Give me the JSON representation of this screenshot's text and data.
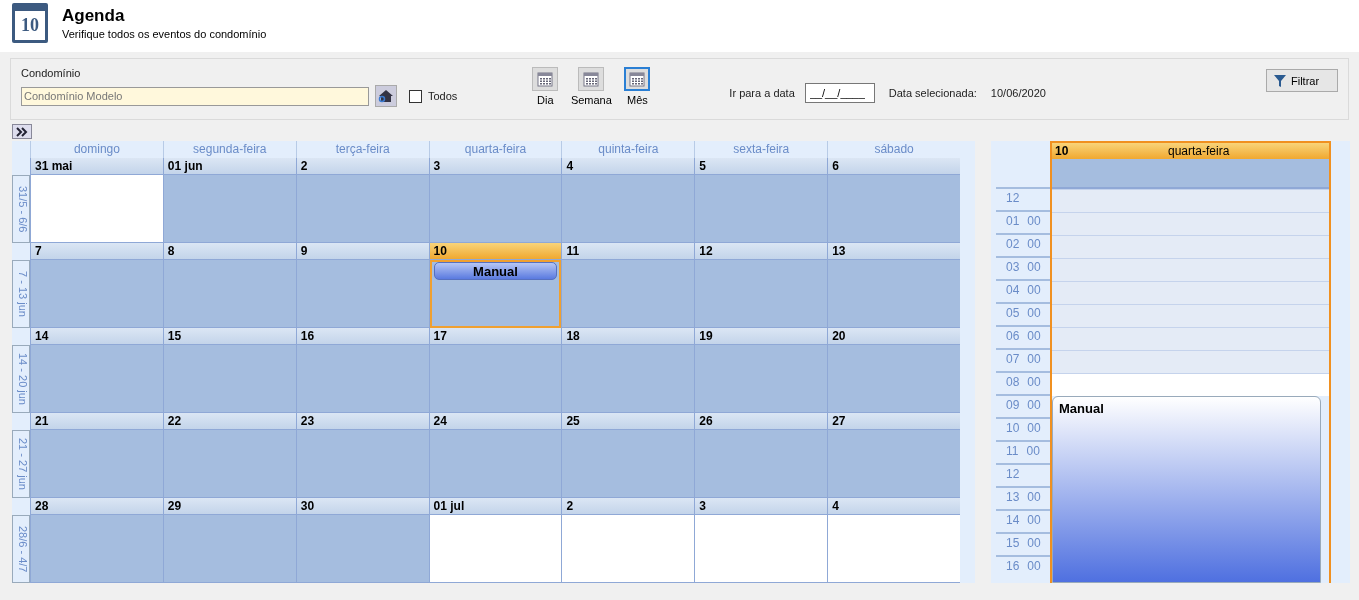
{
  "header": {
    "title": "Agenda",
    "subtitle": "Verifique todos os eventos do condomínio",
    "icon_day": "10"
  },
  "filter": {
    "condo_label": "Condomínio",
    "condo_value": "Condomínio Modelo",
    "all_label": "Todos",
    "all_checked": false,
    "views": [
      {
        "label": "Dia",
        "selected": false
      },
      {
        "label": "Semana",
        "selected": false
      },
      {
        "label": "Mês",
        "selected": true
      }
    ],
    "goto_label": "Ir para a data",
    "goto_placeholder": "__/__/____",
    "selected_label": "Data selecionada:",
    "selected_value": "10/06/2020",
    "filter_button": "Filtrar"
  },
  "month": {
    "weekdays": [
      "domingo",
      "segunda-feira",
      "terça-feira",
      "quarta-feira",
      "quinta-feira",
      "sexta-feira",
      "sábado"
    ],
    "weeks": [
      {
        "label": "31/5 - 6/6",
        "days": [
          {
            "date": "31 mai",
            "shaded": false,
            "selected": false
          },
          {
            "date": "01 jun",
            "shaded": true,
            "selected": false
          },
          {
            "date": "2",
            "shaded": true,
            "selected": false
          },
          {
            "date": "3",
            "shaded": true,
            "selected": false
          },
          {
            "date": "4",
            "shaded": true,
            "selected": false
          },
          {
            "date": "5",
            "shaded": true,
            "selected": false
          },
          {
            "date": "6",
            "shaded": true,
            "selected": false
          }
        ]
      },
      {
        "label": "7 - 13 jun",
        "days": [
          {
            "date": "7",
            "shaded": true,
            "selected": false
          },
          {
            "date": "8",
            "shaded": true,
            "selected": false
          },
          {
            "date": "9",
            "shaded": true,
            "selected": false
          },
          {
            "date": "10",
            "shaded": true,
            "selected": true,
            "events": [
              "Manual"
            ]
          },
          {
            "date": "11",
            "shaded": true,
            "selected": false
          },
          {
            "date": "12",
            "shaded": true,
            "selected": false
          },
          {
            "date": "13",
            "shaded": true,
            "selected": false
          }
        ]
      },
      {
        "label": "14 - 20 jun",
        "days": [
          {
            "date": "14",
            "shaded": true,
            "selected": false
          },
          {
            "date": "15",
            "shaded": true,
            "selected": false
          },
          {
            "date": "16",
            "shaded": true,
            "selected": false
          },
          {
            "date": "17",
            "shaded": true,
            "selected": false
          },
          {
            "date": "18",
            "shaded": true,
            "selected": false
          },
          {
            "date": "19",
            "shaded": true,
            "selected": false
          },
          {
            "date": "20",
            "shaded": true,
            "selected": false
          }
        ]
      },
      {
        "label": "21 - 27 jun",
        "days": [
          {
            "date": "21",
            "shaded": true,
            "selected": false
          },
          {
            "date": "22",
            "shaded": true,
            "selected": false
          },
          {
            "date": "23",
            "shaded": true,
            "selected": false
          },
          {
            "date": "24",
            "shaded": true,
            "selected": false
          },
          {
            "date": "25",
            "shaded": true,
            "selected": false
          },
          {
            "date": "26",
            "shaded": true,
            "selected": false
          },
          {
            "date": "27",
            "shaded": true,
            "selected": false
          }
        ]
      },
      {
        "label": "28/6 - 4/7",
        "days": [
          {
            "date": "28",
            "shaded": true,
            "selected": false
          },
          {
            "date": "29",
            "shaded": true,
            "selected": false
          },
          {
            "date": "30",
            "shaded": true,
            "selected": false
          },
          {
            "date": "01 jul",
            "shaded": false,
            "selected": false
          },
          {
            "date": "2",
            "shaded": false,
            "selected": false
          },
          {
            "date": "3",
            "shaded": false,
            "selected": false
          },
          {
            "date": "4",
            "shaded": false,
            "selected": false
          }
        ]
      }
    ]
  },
  "day_view": {
    "day": "10",
    "weekday": "quarta-feira",
    "slots": [
      {
        "hour": "12",
        "work": false
      },
      {
        "hour": "01",
        "minute": "00",
        "work": false
      },
      {
        "hour": "02",
        "minute": "00",
        "work": false
      },
      {
        "hour": "03",
        "minute": "00",
        "work": false
      },
      {
        "hour": "04",
        "minute": "00",
        "work": false
      },
      {
        "hour": "05",
        "minute": "00",
        "work": false
      },
      {
        "hour": "06",
        "minute": "00",
        "work": false
      },
      {
        "hour": "07",
        "minute": "00",
        "work": false
      },
      {
        "hour": "08",
        "minute": "00",
        "work": true
      },
      {
        "hour": "09",
        "minute": "00",
        "event": "Manual"
      },
      {
        "hour": "10",
        "minute": "00"
      },
      {
        "hour": "11",
        "minute": "00"
      },
      {
        "hour": "12"
      },
      {
        "hour": "13",
        "minute": "00"
      },
      {
        "hour": "14",
        "minute": "00"
      },
      {
        "hour": "15",
        "minute": "00"
      },
      {
        "hour": "16",
        "minute": "00"
      }
    ]
  }
}
